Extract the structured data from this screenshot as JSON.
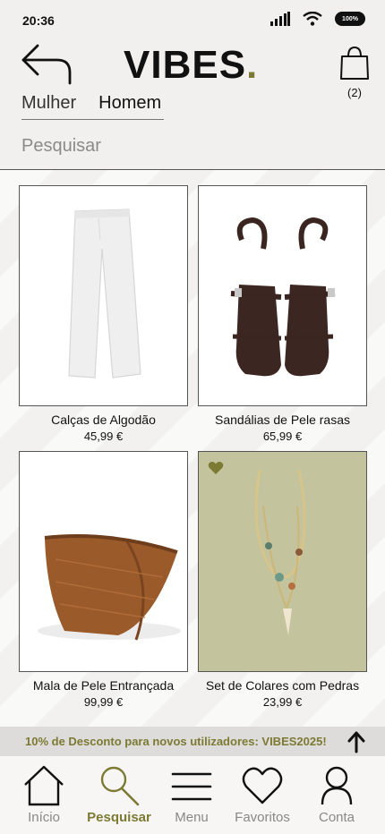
{
  "status": {
    "time": "20:36",
    "battery": "100%"
  },
  "header": {
    "logo_text": "VIBES",
    "logo_dot": ".",
    "cart_count": "(2)"
  },
  "tabs": [
    {
      "label": "Mulher"
    },
    {
      "label": "Homem"
    }
  ],
  "search": {
    "placeholder": "Pesquisar"
  },
  "products": [
    {
      "name": "Calças de Algodão",
      "price": "45,99 €"
    },
    {
      "name": "Sandálias de Pele rasas",
      "price": "65,99 €"
    },
    {
      "name": "Mala de Pele Entrançada",
      "price": "99,99 €"
    },
    {
      "name": "Set de Colares com Pedras",
      "price": "23,99 €"
    }
  ],
  "promo": {
    "text": "10% de Desconto para novos utilizadores: VIBES2025!"
  },
  "nav": [
    {
      "label": "Início",
      "icon": "home-icon"
    },
    {
      "label": "Pesquisar",
      "icon": "search-icon"
    },
    {
      "label": "Menu",
      "icon": "menu-icon"
    },
    {
      "label": "Favoritos",
      "icon": "heart-icon"
    },
    {
      "label": "Conta",
      "icon": "user-icon"
    }
  ],
  "colors": {
    "accent": "#7c7a33",
    "background": "#f1f0ef"
  }
}
